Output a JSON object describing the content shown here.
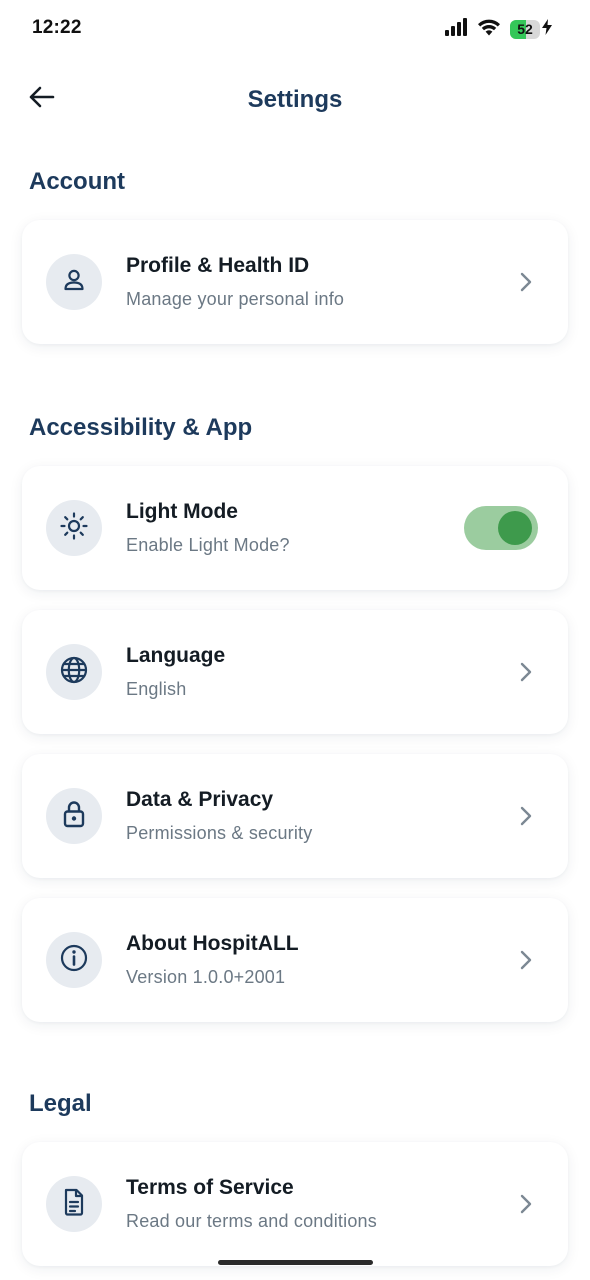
{
  "status_bar": {
    "time": "12:22",
    "battery_level": "52",
    "battery_percent": 52,
    "signal_icon": "cellular-signal-icon",
    "wifi_icon": "wifi-icon",
    "charging_icon": "charging-bolt-icon"
  },
  "header": {
    "title": "Settings",
    "back_icon": "arrow-left-icon"
  },
  "sections": {
    "account": {
      "title": "Account",
      "items": [
        {
          "title": "Profile & Health ID",
          "subtitle": "Manage your personal info",
          "icon": "person-icon"
        }
      ]
    },
    "accessibility": {
      "title": "Accessibility & App",
      "items": [
        {
          "title": "Light Mode",
          "subtitle": "Enable Light Mode?",
          "icon": "sun-icon",
          "toggle_on": true
        },
        {
          "title": "Language",
          "subtitle": "English",
          "icon": "globe-icon"
        },
        {
          "title": "Data & Privacy",
          "subtitle": "Permissions & security",
          "icon": "lock-icon"
        },
        {
          "title": "About HospitALL",
          "subtitle": "Version 1.0.0+2001",
          "icon": "info-icon"
        }
      ]
    },
    "legal": {
      "title": "Legal",
      "items": [
        {
          "title": "Terms of Service",
          "subtitle": "Read our terms and conditions",
          "icon": "document-icon"
        }
      ]
    }
  },
  "colors": {
    "heading": "#1d3a5c",
    "icon_bg": "#e7ebf0",
    "toggle_track": "#9bcc9f",
    "toggle_knob": "#3e9a4c",
    "battery_green": "#34c759"
  }
}
